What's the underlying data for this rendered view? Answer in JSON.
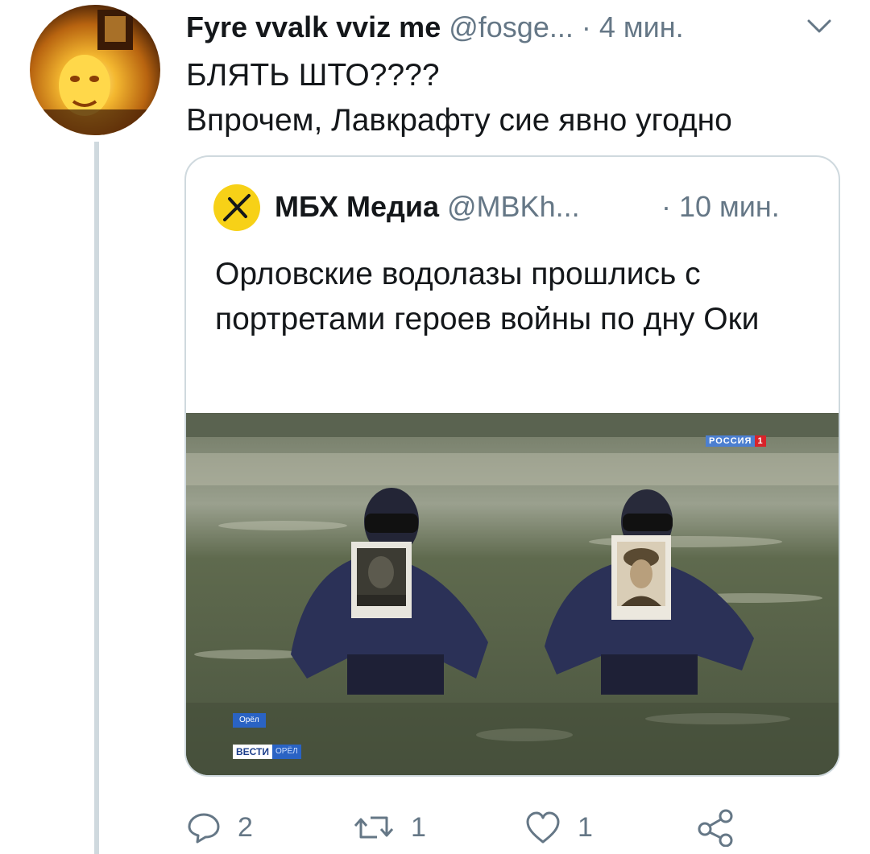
{
  "tweet": {
    "author_name": "Fyre vvalk vviz me",
    "author_handle": "@fosge...",
    "dot": "·",
    "time": "4 мин.",
    "text_lines": [
      "БЛЯТЬ ШТО????",
      "Впрочем, Лавкрафту сие явно угодно"
    ]
  },
  "quoted": {
    "author_name": "МБХ Медиа",
    "author_handle": "@MBKh...",
    "time": "· 10 мин.",
    "text": "Орловские водолазы прошлись с портретами героев войны по дну Оки",
    "media": {
      "channel_logo": "РОССИЯ",
      "channel_number": "1",
      "location_tag": "Орёл",
      "news_tag": "ВЕСТИ",
      "news_tag_region": "ОРЁЛ"
    }
  },
  "actions": {
    "reply_count": "2",
    "retweet_count": "1",
    "like_count": "1"
  },
  "icons": [
    "avatar",
    "chevron-down-icon",
    "mbx-logo-icon",
    "reply-icon",
    "retweet-icon",
    "like-icon",
    "share-icon"
  ],
  "colors": {
    "secondary_text": "#657786",
    "border": "#cfd9de",
    "mbx_yellow": "#f7d117"
  }
}
